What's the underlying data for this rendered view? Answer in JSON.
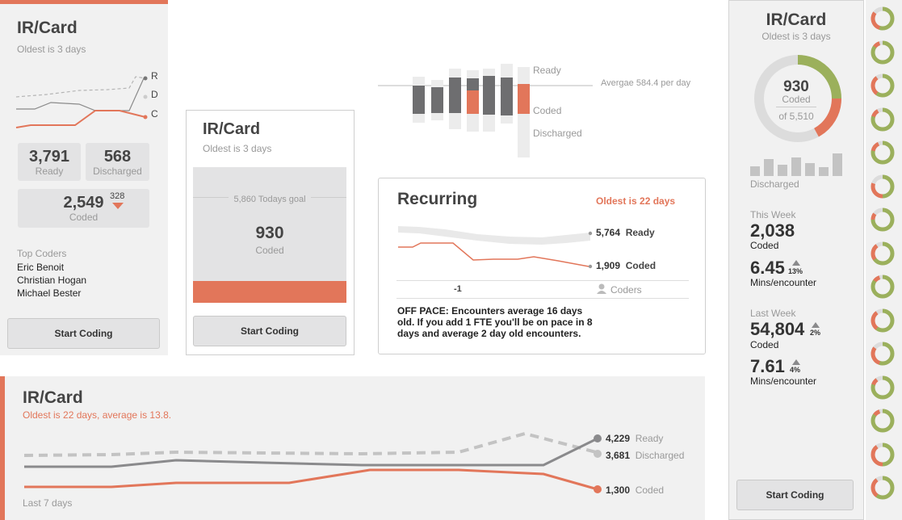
{
  "colors": {
    "accent": "#e2765a",
    "green": "#9bb05c",
    "dark": "#6e6e70",
    "light": "#d9d9d9"
  },
  "card1": {
    "title": "IR/Card",
    "subtitle": "Oldest is 3 days",
    "legend": [
      "R",
      "D",
      "C"
    ],
    "ready_value": "3,791",
    "ready_label": "Ready",
    "discharged_value": "568",
    "discharged_label": "Discharged",
    "coded_value": "2,549",
    "coded_change": "328",
    "coded_label": "Coded",
    "top_coders_label": "Top Coders",
    "coders": [
      "Eric Benoit",
      "Christian Hogan",
      "Michael Bester"
    ],
    "button": "Start Coding"
  },
  "card2": {
    "title": "IR/Card",
    "subtitle": "Oldest is 3 days",
    "goal": "5,860 Todays goal",
    "value": "930",
    "label": "Coded",
    "progress": 0.16,
    "button": "Start Coding"
  },
  "topchart": {
    "ready_label": "Ready",
    "coded_label": "Coded",
    "discharged_label": "Discharged",
    "average_label": "Avergae 584.4 per day"
  },
  "recurring": {
    "title": "Recurring",
    "oldest": "Oldest is 22 days",
    "ready_value": "5,764",
    "ready_label": "Ready",
    "coded_value": "1,909",
    "coded_label": "Coded",
    "axis_label": "-1",
    "coders_label": "Coders",
    "message": "OFF PACE: Encounters average 16 days old. If you add 1 FTE you'll be on pace in 8 days and average 2 day old encounters."
  },
  "bottom": {
    "title": "IR/Card",
    "subtitle": "Oldest is 22 days, average is 13.8.",
    "ready_value": "4,229",
    "ready_label": "Ready",
    "discharged_value": "3,681",
    "discharged_label": "Discharged",
    "coded_value": "1,300",
    "coded_label": "Coded",
    "footer": "Last 7 days"
  },
  "right": {
    "title": "IR/Card",
    "subtitle": "Oldest is 3 days",
    "donut_value": "930",
    "donut_label": "Coded",
    "donut_of": "of 5,510",
    "donut_segments": {
      "green": 0.25,
      "red": 0.17
    },
    "discharged_label": "Discharged",
    "this_week_label": "This Week",
    "this_week_coded": "2,038",
    "coded_label": "Coded",
    "this_week_mins": "6.45",
    "this_week_mins_change": "13%",
    "mins_label": "Mins/encounter",
    "last_week_label": "Last Week",
    "last_week_coded": "54,804",
    "last_week_coded_change": "2%",
    "last_week_mins": "7.61",
    "last_week_mins_change": "4%",
    "button": "Start Coding"
  },
  "mini_donuts": [
    {
      "green": 0.55,
      "red": 0.3
    },
    {
      "green": 0.85,
      "red": 0.1
    },
    {
      "green": 0.6,
      "red": 0.3
    },
    {
      "green": 0.8,
      "red": 0.12
    },
    {
      "green": 0.78,
      "red": 0.15
    },
    {
      "green": 0.5,
      "red": 0.3
    },
    {
      "green": 0.75,
      "red": 0.1
    },
    {
      "green": 0.65,
      "red": 0.25
    },
    {
      "green": 0.85,
      "red": 0.1
    },
    {
      "green": 0.6,
      "red": 0.3
    },
    {
      "green": 0.55,
      "red": 0.3
    },
    {
      "green": 0.8,
      "red": 0.1
    },
    {
      "green": 0.85,
      "red": 0.1
    },
    {
      "green": 0.5,
      "red": 0.4
    },
    {
      "green": 0.6,
      "red": 0.3
    }
  ]
}
